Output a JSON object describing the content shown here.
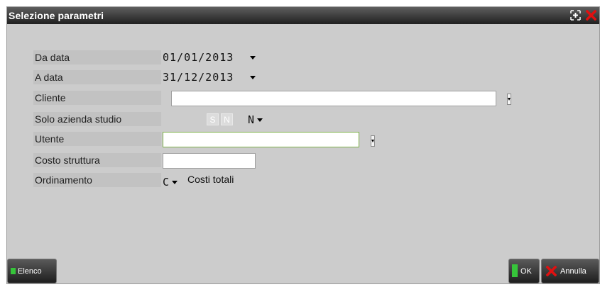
{
  "window": {
    "title": "Selezione parametri",
    "maximize_icon": "maximize-icon",
    "close_icon": "close-icon"
  },
  "fields": {
    "da_data": {
      "label": "Da data",
      "value": "01/01/2013"
    },
    "a_data": {
      "label": "A  data",
      "value": "31/12/2013"
    },
    "cliente": {
      "label": "Cliente",
      "value": ""
    },
    "solo_azienda": {
      "label": "Solo azienda studio",
      "option_s": "S",
      "option_n": "N",
      "value": "N"
    },
    "utente": {
      "label": "Utente",
      "value": ""
    },
    "costo_struttura": {
      "label": "Costo struttura",
      "value": ""
    },
    "ordinamento": {
      "label": "Ordinamento",
      "value": "C",
      "description": "Costi totali"
    }
  },
  "buttons": {
    "elenco": "Elenco",
    "ok": "OK",
    "annulla": "Annulla"
  },
  "colors": {
    "title_bar": "#202020",
    "accent_green": "#36c43a",
    "close_red": "#e01010",
    "focused_border": "#7db04a"
  }
}
